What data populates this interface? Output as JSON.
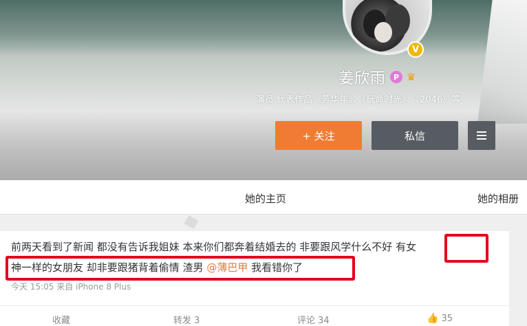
{
  "profile": {
    "name": "姜欣雨",
    "works_line": "演员 代表作品《芳华年》、《玩命时光》、《2046》等",
    "verified_badge": "V",
    "p_badge": "P"
  },
  "buttons": {
    "follow": "+ 关注",
    "message": "私信"
  },
  "tabs": {
    "home": "她的主页",
    "album": "她的相册"
  },
  "post": {
    "line1": "前两天看到了新闻 都没有告诉我姐妹 本来你们都奔着结婚去的 非要跟风学什么不好 有女",
    "line2_before": "神一样的女朋友 却非要跟猪背着偷情 渣男 ",
    "mention": "@薄巴甲",
    "line2_after": " 我看错你了",
    "meta": "今天 15:05 来自 iPhone 8 Plus"
  },
  "actions": {
    "collect": "收藏",
    "repost": "转发 3",
    "comment": "评论 34",
    "like": "35"
  },
  "colors": {
    "follow": "#f07c33",
    "secondary_button": "#575c63",
    "highlight": "#e3001b",
    "mention": "#e07b3c"
  },
  "icons": [
    "verified-icon",
    "p-badge-icon",
    "member-icon",
    "menu-icon",
    "thumb-up-icon"
  ]
}
